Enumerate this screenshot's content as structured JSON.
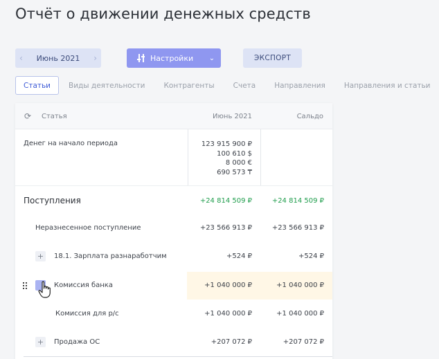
{
  "page": {
    "title": "Отчёт о движении денежных средств"
  },
  "toolbar": {
    "period": "Июнь 2021",
    "period_prev": "‹",
    "period_next": "›",
    "settings_label": "Настройки",
    "settings_dropdown": "⌄",
    "export_label": "ЭКСПОРТ"
  },
  "tabs": [
    {
      "label": "Статьи",
      "active": true
    },
    {
      "label": "Виды деятельности"
    },
    {
      "label": "Контрагенты"
    },
    {
      "label": "Счета"
    },
    {
      "label": "Направления"
    },
    {
      "label": "Направления и статьи"
    }
  ],
  "table": {
    "headers": {
      "article": "Статья",
      "month": "Июнь 2021",
      "saldo": "Сальдо"
    },
    "opening": {
      "name": "Денег на начало периода",
      "values": [
        "123 915 900 ₽",
        "100 610 $",
        "8 000 €",
        "690 573 ₸"
      ]
    },
    "section": {
      "name": "Поступления",
      "month": "+24 814 509 ₽",
      "saldo": "+24 814 509 ₽"
    },
    "rows": [
      {
        "name": "Неразнесенное поступление",
        "month": "+23 566 913 ₽",
        "saldo": "+23 566 913 ₽"
      },
      {
        "name": "18.1. Зарплата разнаработчим",
        "month": "+524 ₽",
        "saldo": "+524 ₽"
      },
      {
        "name": "Комиссия банка",
        "month": "+1 040 000 ₽",
        "saldo": "+1 040 000 ₽"
      },
      {
        "name": "Комиссия для р/с",
        "month": "+1 040 000 ₽",
        "saldo": "+1 040 000 ₽"
      },
      {
        "name": "Продажа ОС",
        "month": "+207 072 ₽",
        "saldo": "+207 072 ₽"
      }
    ],
    "plus_symbol": "+",
    "refresh_symbol": "⟳"
  },
  "colors": {
    "accent": "#3d5ad6",
    "button": "#8f97f0",
    "positive": "#1f9d4c",
    "highlight": "#fff7e6"
  }
}
